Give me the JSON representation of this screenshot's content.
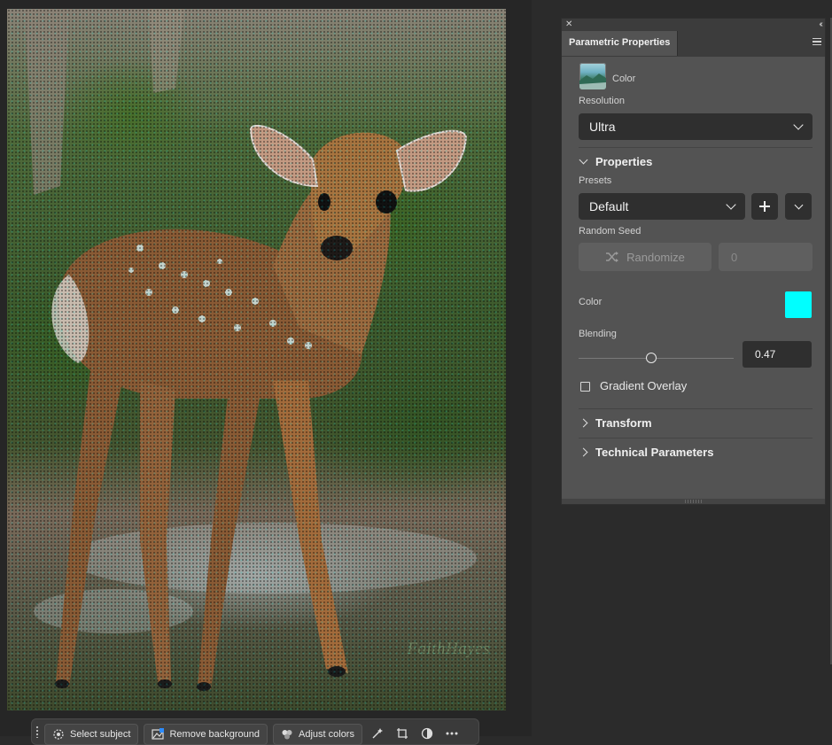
{
  "panel": {
    "tab_label": "Parametric Properties",
    "source_label": "Color",
    "resolution_label": "Resolution",
    "resolution_value": "Ultra",
    "properties_header": "Properties",
    "presets_label": "Presets",
    "presets_value": "Default",
    "random_seed_label": "Random Seed",
    "randomize_label": "Randomize",
    "seed_value": "0",
    "color_label": "Color",
    "color_value": "#00ffff",
    "blending_label": "Blending",
    "blending_value": "0.47",
    "gradient_overlay_label": "Gradient Overlay",
    "gradient_overlay_checked": false,
    "transform_header": "Transform",
    "technical_header": "Technical Parameters"
  },
  "canvas": {
    "watermark": "FaithHayes"
  },
  "taskbar": {
    "select_subject": "Select subject",
    "remove_background": "Remove background",
    "adjust_colors": "Adjust colors"
  }
}
